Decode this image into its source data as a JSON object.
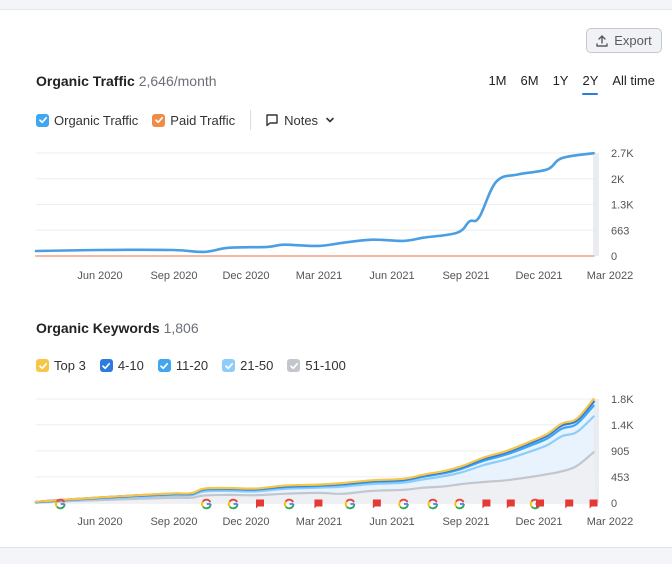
{
  "export_button": {
    "label": "Export",
    "icon": "upload-icon"
  },
  "traffic": {
    "title": "Organic Traffic",
    "value": "2,646/month",
    "time_ranges": [
      {
        "label": "1M",
        "active": false
      },
      {
        "label": "6M",
        "active": false
      },
      {
        "label": "1Y",
        "active": false
      },
      {
        "label": "2Y",
        "active": true
      },
      {
        "label": "All time",
        "active": false
      }
    ],
    "legend": [
      {
        "label": "Organic Traffic",
        "color": "#3fa6f0",
        "checked": true
      },
      {
        "label": "Paid Traffic",
        "color": "#f08c47",
        "checked": true
      }
    ],
    "notes_label": "Notes"
  },
  "keywords": {
    "title": "Organic Keywords",
    "value": "1,806",
    "legend": [
      {
        "label": "Top 3",
        "color": "#f7c548",
        "checked": true
      },
      {
        "label": "4-10",
        "color": "#2d7be0",
        "checked": true
      },
      {
        "label": "11-20",
        "color": "#3fa6f0",
        "checked": true
      },
      {
        "label": "21-50",
        "color": "#8dcdfa",
        "checked": true
      },
      {
        "label": "51-100",
        "color": "#c3c6cd",
        "checked": true
      }
    ]
  },
  "chart_data": [
    {
      "type": "line",
      "title": "Organic Traffic",
      "x_tick_labels": [
        "Jun 2020",
        "Sep 2020",
        "Dec 2020",
        "Mar 2021",
        "Jun 2021",
        "Sep 2021",
        "Dec 2021",
        "Mar 2022"
      ],
      "x_range_months": [
        0,
        23
      ],
      "x_start": "Mar 2020",
      "y_tick_labels": [
        "0",
        "663",
        "1.3K",
        "2K",
        "2.7K"
      ],
      "y_ticks": [
        0,
        663,
        1326,
        1989,
        2652
      ],
      "ylim": [
        0,
        2652
      ],
      "grid": true,
      "series": [
        {
          "name": "Organic Traffic",
          "color": "#4a9ee3",
          "x": [
            0,
            2.6,
            5.6,
            6.9,
            7.9,
            9.5,
            10.2,
            11.6,
            12.6,
            13.8,
            15.1,
            15.9,
            17.3,
            17.8,
            18.2,
            18.9,
            19.8,
            21.0,
            21.6,
            22.9
          ],
          "values": [
            130,
            155,
            155,
            105,
            210,
            235,
            290,
            260,
            340,
            420,
            390,
            470,
            600,
            890,
            995,
            1910,
            2100,
            2230,
            2520,
            2646
          ]
        },
        {
          "name": "Paid Traffic",
          "color": "#f4b9a0",
          "x": [
            0,
            22.9
          ],
          "values": [
            0,
            0
          ]
        }
      ]
    },
    {
      "type": "area",
      "title": "Organic Keywords",
      "x_tick_labels": [
        "Jun 2020",
        "Sep 2020",
        "Dec 2020",
        "Mar 2021",
        "Jun 2021",
        "Sep 2021",
        "Dec 2021",
        "Mar 2022"
      ],
      "x_range_months": [
        0,
        23
      ],
      "x_start": "Mar 2020",
      "y_tick_labels": [
        "0",
        "453",
        "905",
        "1.4K",
        "1.8K"
      ],
      "y_ticks": [
        0,
        453,
        905,
        1358,
        1806
      ],
      "ylim": [
        0,
        1806
      ],
      "grid": true,
      "x": [
        0,
        1.3,
        2.6,
        4.0,
        5.6,
        6.4,
        6.9,
        7.9,
        9.0,
        10.2,
        11.6,
        12.6,
        13.8,
        15.1,
        15.9,
        16.8,
        17.5,
        18.4,
        19.3,
        20.2,
        21.0,
        21.6,
        22.2,
        22.9
      ],
      "series": [
        {
          "name": "Top 3",
          "color": "#f7c548",
          "values": [
            20,
            60,
            95,
            130,
            165,
            170,
            250,
            260,
            250,
            300,
            320,
            345,
            395,
            420,
            490,
            560,
            640,
            790,
            900,
            1050,
            1200,
            1380,
            1460,
            1806
          ]
        },
        {
          "name": "4-10",
          "color": "#2d7be0",
          "values": [
            18,
            58,
            92,
            126,
            160,
            165,
            243,
            253,
            243,
            292,
            312,
            336,
            385,
            410,
            478,
            545,
            625,
            770,
            880,
            1025,
            1172,
            1350,
            1430,
            1760
          ]
        },
        {
          "name": "11-20",
          "color": "#3fa6f0",
          "values": [
            15,
            54,
            86,
            118,
            150,
            155,
            230,
            240,
            230,
            276,
            296,
            318,
            365,
            390,
            455,
            520,
            595,
            735,
            840,
            980,
            1120,
            1290,
            1370,
            1690
          ]
        },
        {
          "name": "21-50",
          "color": "#8dcdfa",
          "values": [
            10,
            45,
            74,
            102,
            130,
            135,
            200,
            210,
            200,
            245,
            265,
            285,
            330,
            352,
            410,
            468,
            535,
            660,
            755,
            880,
            1005,
            1160,
            1230,
            1500
          ]
        },
        {
          "name": "51-100",
          "color": "#c3c6cd",
          "values": [
            5,
            30,
            50,
            70,
            90,
            92,
            130,
            140,
            135,
            160,
            175,
            160,
            210,
            230,
            265,
            290,
            330,
            365,
            395,
            445,
            500,
            550,
            640,
            880
          ]
        }
      ],
      "markers": {
        "google_update_x": [
          1.0,
          7.0,
          8.1,
          10.4,
          12.9,
          15.1,
          16.3,
          17.4,
          20.5
        ],
        "note_flag_x": [
          9.2,
          11.6,
          14.0,
          18.5,
          19.5,
          20.7,
          21.9,
          22.9
        ],
        "google_update_months_text": "G",
        "flag_color": "#e53935"
      }
    }
  ]
}
